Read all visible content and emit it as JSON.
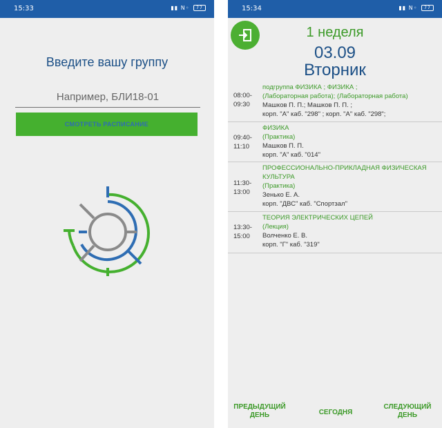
{
  "left_screen": {
    "status": {
      "time": "15:33",
      "indicators": "▮▮ Ν◦",
      "battery": "77"
    },
    "prompt": "Введите вашу группу",
    "group_input": {
      "value": "",
      "placeholder": "Например, БЛИ18-01"
    },
    "view_button": "СМОТРЕТЬ РАСПИСАНИЕ",
    "logo_icon": "university-logo-icon",
    "colors": {
      "accent_green": "#45b02f",
      "dark_blue": "#1b4f86",
      "blue": "#2e6db3",
      "grey": "#8a8a8a"
    }
  },
  "right_screen": {
    "status": {
      "time": "15:34",
      "indicators": "▮▮ Ν◦",
      "battery": "77"
    },
    "exit_icon": "exit-icon",
    "week": "1 неделя",
    "date": "03.09",
    "weekday": "Вторник",
    "lessons": [
      {
        "start": "08:00-",
        "end": "09:30",
        "subject": "подгруппа ФИЗИКА ; ФИЗИКА ;",
        "type": "(Лабораторная работа); (Лабораторная работа)",
        "teacher": "Машков П. П.; Машков П. П. ;",
        "room": "корп. \"А\" каб. \"298\" ; корп. \"А\" каб. \"298\";"
      },
      {
        "start": "09:40-",
        "end": "11:10",
        "subject": "ФИЗИКА",
        "type": "(Практика)",
        "teacher": "Машков П. П.",
        "room": "корп. \"А\" каб. \"014\""
      },
      {
        "start": "11:30-",
        "end": "13:00",
        "subject": "ПРОФЕССИОНАЛЬНО-ПРИКЛАДНАЯ ФИЗИЧЕСКАЯ КУЛЬТУРА",
        "type": "(Практика)",
        "teacher": "Зенько Е. А.",
        "room": "корп. \"ДВС\" каб. \"Спортзал\""
      },
      {
        "start": "13:30-",
        "end": "15:00",
        "subject": "ТЕОРИЯ ЭЛЕКТРИЧЕСКИХ ЦЕПЕЙ",
        "type": "(Лекция)",
        "teacher": "Волченко Е. В.",
        "room": "корп. \"Г\" каб. \"319\""
      }
    ],
    "nav": {
      "prev": "ПРЕДЫДУЩИЙ ДЕНЬ",
      "today": "СЕГОДНЯ",
      "next": "СЛЕДУЮЩИЙ ДЕНЬ"
    }
  }
}
